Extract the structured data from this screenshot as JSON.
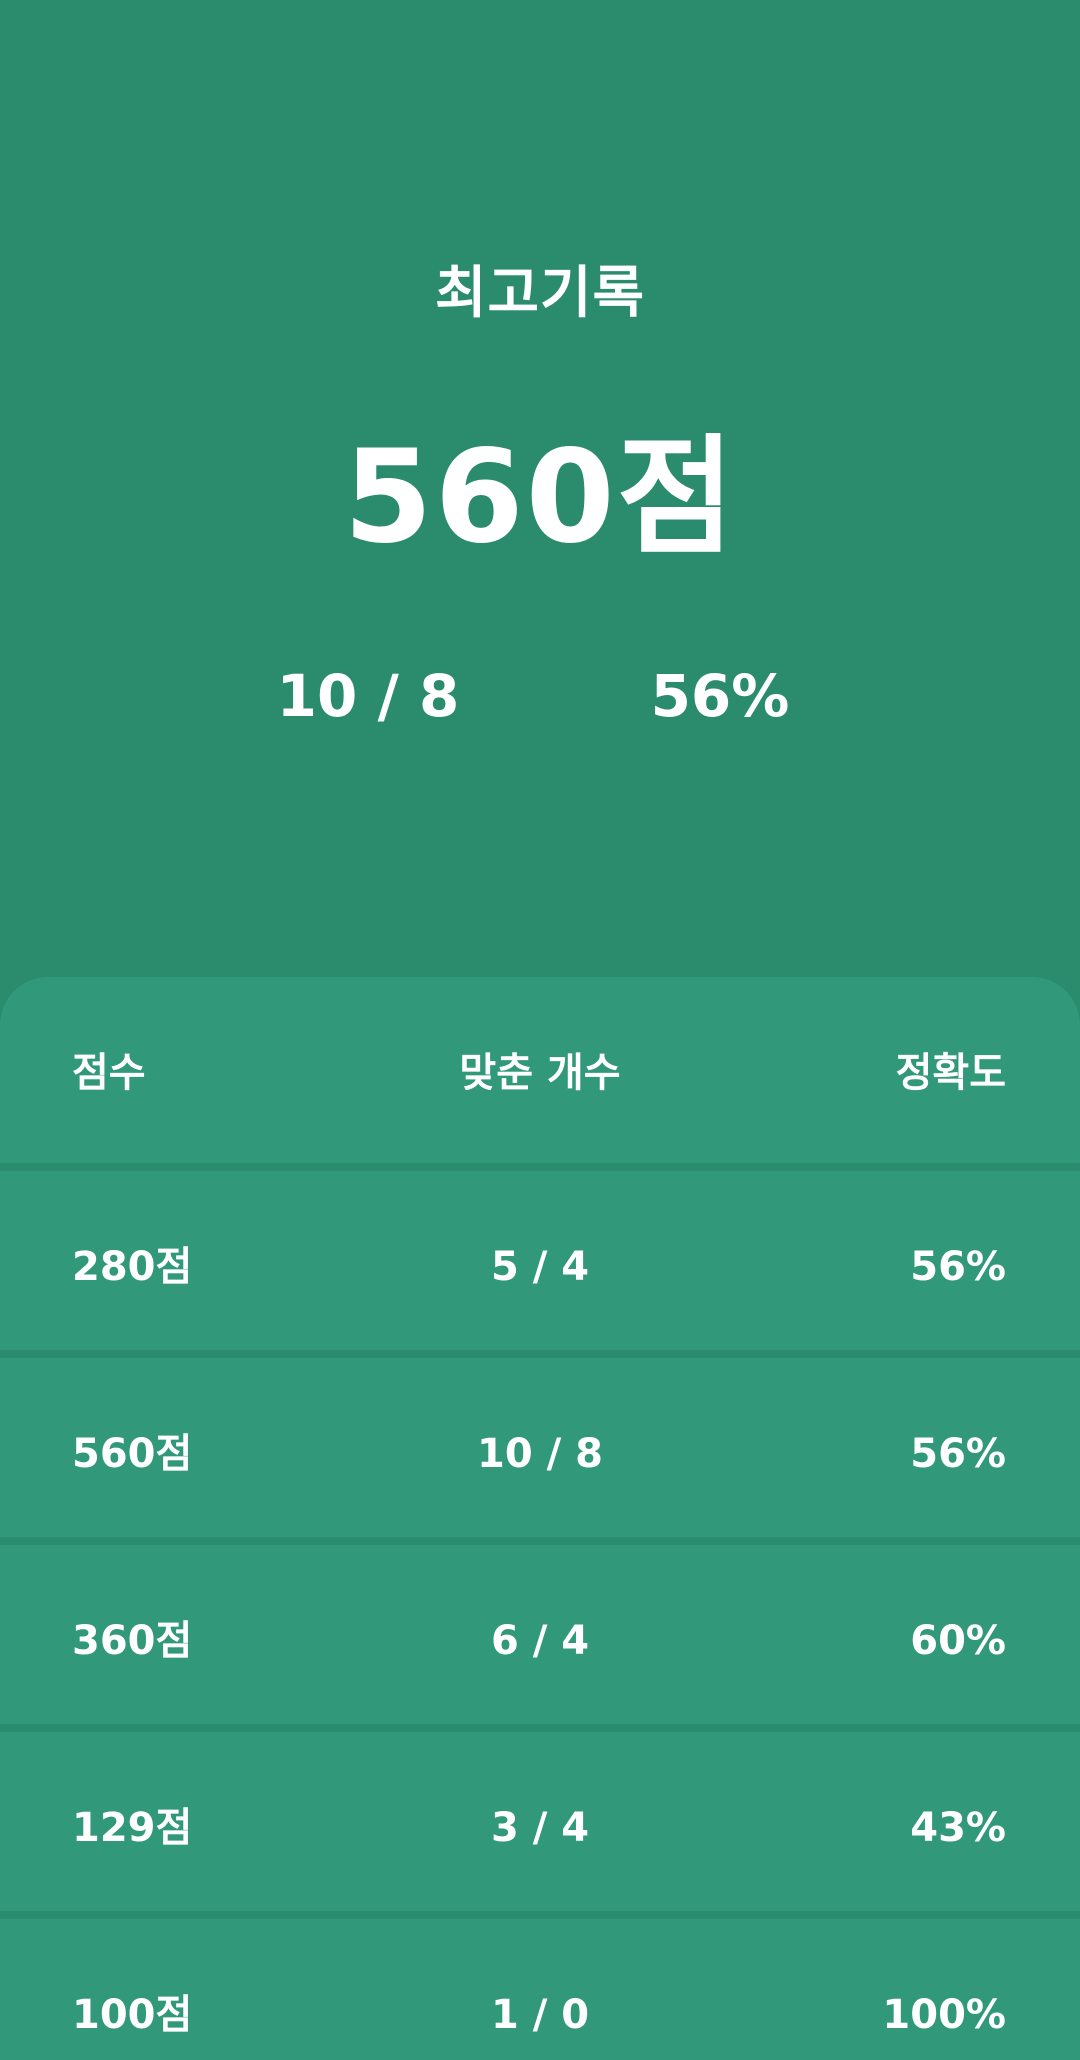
{
  "best": {
    "title": "최고기록",
    "score": "560점",
    "correct": "10 / 8",
    "accuracy": "56%"
  },
  "history": {
    "headers": {
      "score": "점수",
      "correct": "맞춘 개수",
      "accuracy": "정확도"
    },
    "rows": [
      {
        "score": "280점",
        "correct": "5 / 4",
        "accuracy": "56%"
      },
      {
        "score": "560점",
        "correct": "10 / 8",
        "accuracy": "56%"
      },
      {
        "score": "360점",
        "correct": "6 / 4",
        "accuracy": "60%"
      },
      {
        "score": "129점",
        "correct": "3 / 4",
        "accuracy": "43%"
      },
      {
        "score": "100점",
        "correct": "1 / 0",
        "accuracy": "100%"
      }
    ]
  },
  "colors": {
    "background": "#2a8c6d",
    "panel": "#31987a",
    "text": "#ffffff"
  }
}
